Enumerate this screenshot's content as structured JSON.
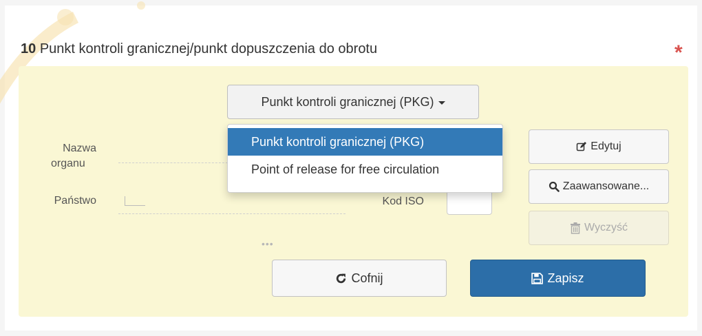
{
  "section": {
    "number": "10",
    "title": "Punkt kontroli granicznej/punkt dopuszczenia do obrotu",
    "required_mark": "*"
  },
  "type_select": {
    "value": "Punkt kontroli granicznej (PKG)",
    "options": [
      "Punkt kontroli granicznej (PKG)",
      "Point of release for free circulation"
    ],
    "selected_index": 0
  },
  "fields": {
    "authority_label_line1": "Nazwa",
    "authority_label_line2": "organu",
    "country_label": "Państwo",
    "iso_label": "Kod ISO",
    "more_indicator": "•••"
  },
  "side_buttons": {
    "edit": "Edytuj",
    "advanced": "Zaawansowane...",
    "clear": "Wyczyść"
  },
  "actions": {
    "undo": "Cofnij",
    "save": "Zapisz"
  },
  "colors": {
    "panel_bg": "#faf7d4",
    "primary": "#2c6ea8",
    "selected": "#337ab7",
    "required": "#d9534f"
  },
  "icons": {
    "edit": "edit-icon",
    "advanced": "search-icon",
    "clear": "trash-icon",
    "undo": "refresh-icon",
    "save": "floppy-disk-icon"
  }
}
